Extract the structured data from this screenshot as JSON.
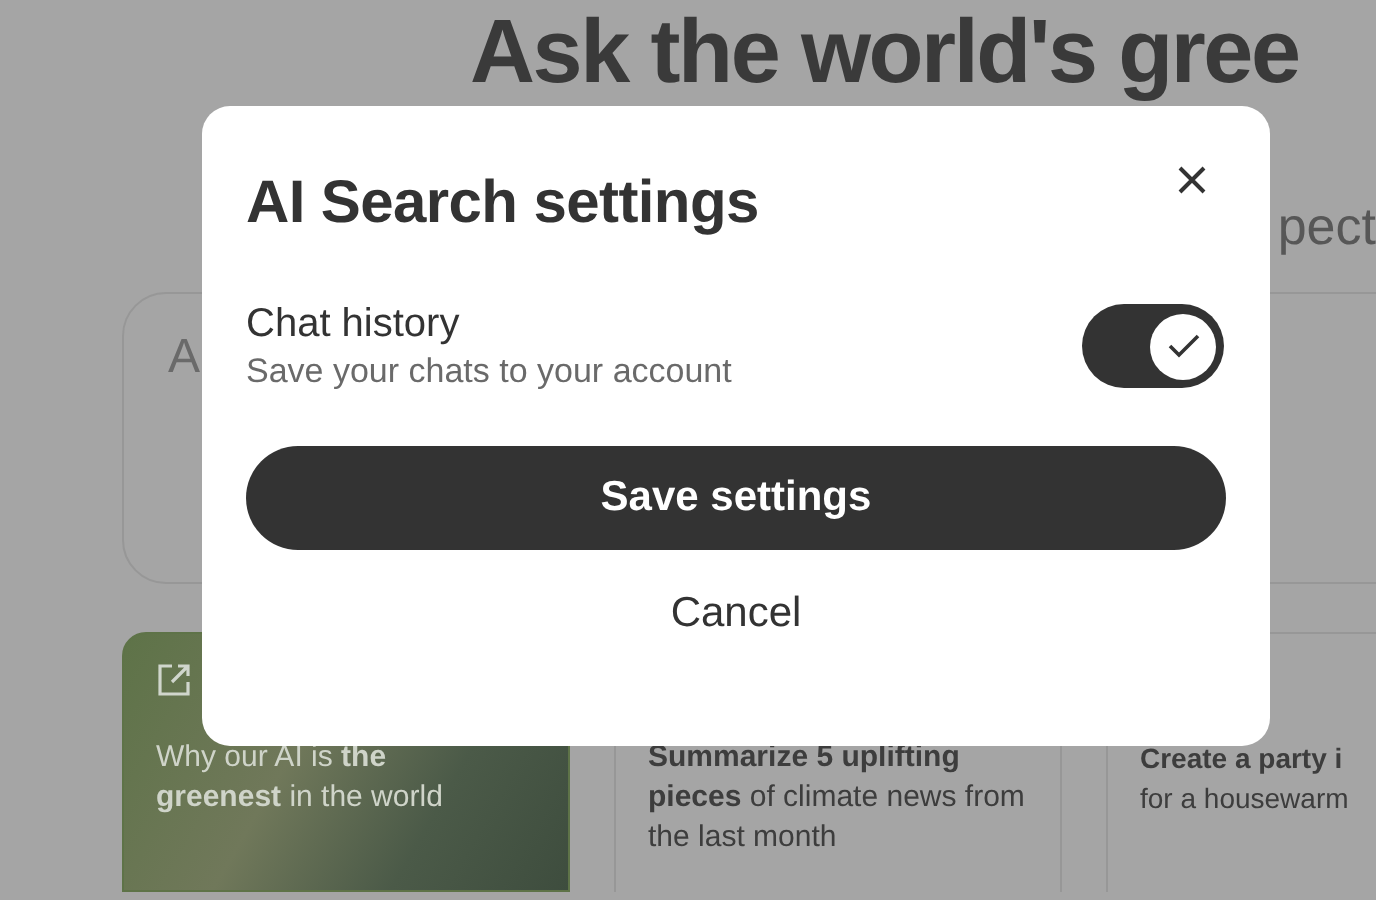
{
  "background": {
    "heading": "Ask the world's gree",
    "subheading": "pect",
    "search": {
      "placeholder": "A"
    },
    "cards": [
      {
        "kind": "link",
        "text": "Why our AI is **the greenest** in the world"
      },
      {
        "kind": "prompt",
        "text": "**Summarize 5 uplifting pieces** of climate news from the last month"
      },
      {
        "kind": "prompt",
        "text": "**Create a party i** for a housewarm"
      }
    ]
  },
  "dialog": {
    "title": "AI Search settings",
    "settings": [
      {
        "label": "Chat history",
        "description": "Save your chats to your account",
        "on": true
      }
    ],
    "buttons": [
      {
        "kind": "primary",
        "label": "Save settings"
      },
      {
        "kind": "text",
        "label": "Cancel"
      }
    ]
  }
}
